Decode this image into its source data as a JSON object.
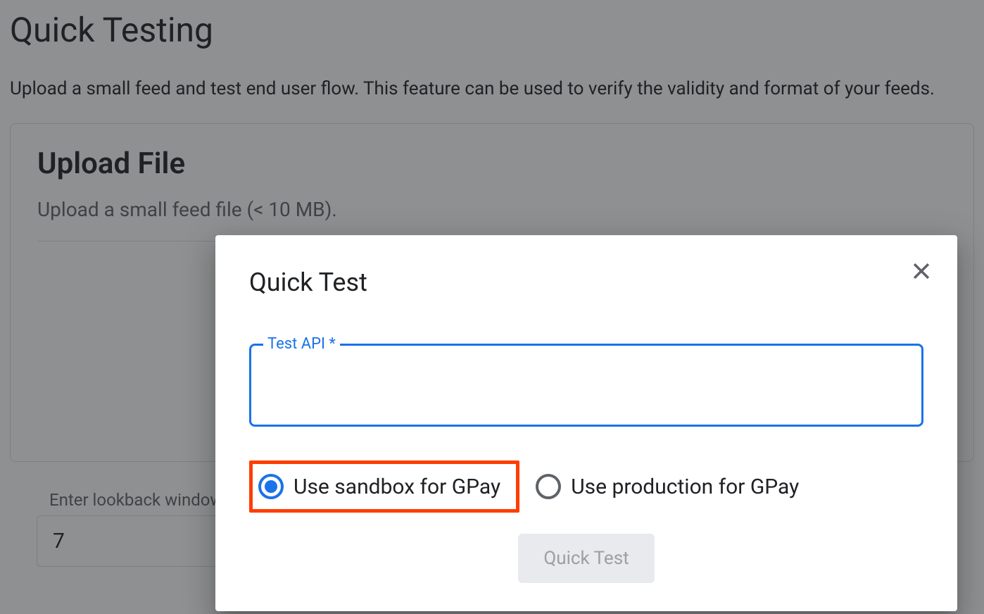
{
  "page": {
    "title": "Quick Testing",
    "subtitle": "Upload a small feed and test end user flow. This feature can be used to verify the validity and format of your feeds."
  },
  "upload": {
    "title": "Upload File",
    "subtitle": "Upload a small feed file (< 10 MB)."
  },
  "lookback": {
    "label": "Enter lookback window",
    "value": "7"
  },
  "dialog": {
    "title": "Quick Test",
    "field_label": "Test API *",
    "field_value": "",
    "radios": {
      "sandbox": "Use sandbox for GPay",
      "production": "Use production for GPay"
    },
    "submit_label": "Quick Test"
  }
}
